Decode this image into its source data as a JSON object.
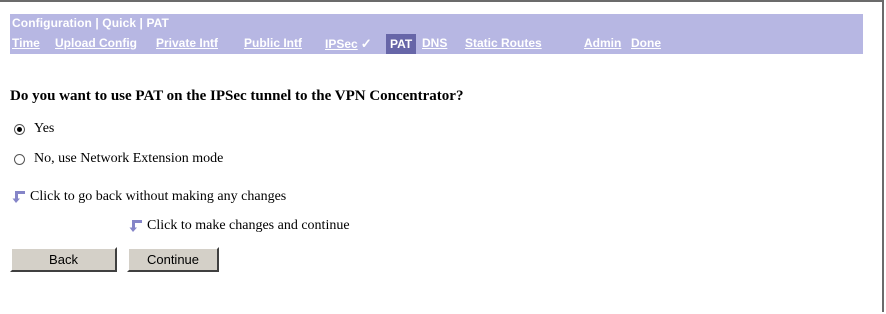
{
  "header": {
    "breadcrumb": "Configuration | Quick | PAT",
    "nav": {
      "time": "Time",
      "upload_config": "Upload Config",
      "private_intf": "Private Intf",
      "public_intf": "Public Intf",
      "ipsec": "IPSec",
      "pat": "PAT",
      "dns": "DNS",
      "static_routes": "Static Routes",
      "admin": "Admin",
      "done": "Done"
    },
    "ipsec_check": "✓"
  },
  "form": {
    "question": "Do you want to use PAT on the IPSec tunnel to the VPN Concentrator?",
    "options": [
      {
        "label": "Yes",
        "selected": true
      },
      {
        "label": "No, use Network Extension mode",
        "selected": false
      }
    ],
    "back_hint": "Click to go back without making any changes",
    "continue_hint": "Click to make changes and continue",
    "back_label": "Back",
    "continue_label": "Continue"
  },
  "colors": {
    "header_bg": "#b7b7e3",
    "active_tab_bg": "#6766a8",
    "arrow": "#8585c8"
  }
}
